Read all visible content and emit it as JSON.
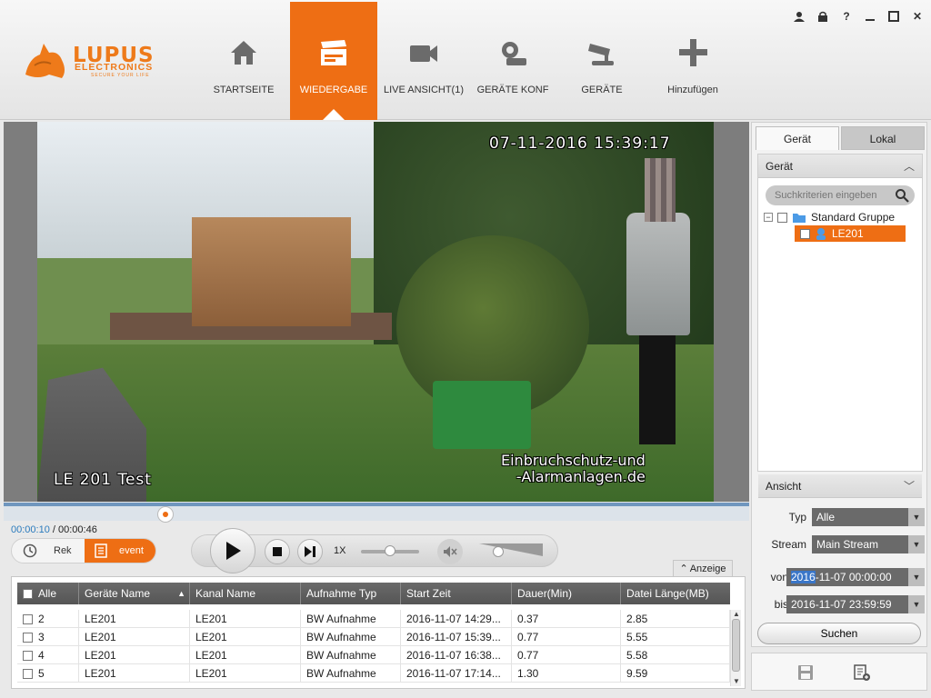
{
  "window_controls": [
    "user-icon",
    "lock-icon",
    "help-icon",
    "minimize-icon",
    "maximize-icon",
    "close-icon"
  ],
  "window_glyphs": {
    "help": "?",
    "close": "✕"
  },
  "brand": {
    "name": "LUPUS",
    "sub": "ELECTRONICS",
    "tagline": "SECURE YOUR LIFE",
    "color": "#ee7a1a"
  },
  "nav": {
    "active_color": "#ee6e14",
    "items": [
      {
        "label": "STARTSEITE",
        "icon": "home-icon"
      },
      {
        "label": "WIEDERGABE",
        "icon": "clapperboard-icon",
        "active": true
      },
      {
        "label": "LIVE ANSICHT(1)",
        "icon": "video-camera-icon"
      },
      {
        "label": "GERÄTE KONF",
        "icon": "gear-config-icon"
      },
      {
        "label": "GERÄTE",
        "icon": "cctv-camera-icon"
      },
      {
        "label": "Hinzufügen",
        "icon": "plus-icon"
      }
    ]
  },
  "video": {
    "osd_timestamp": "07-11-2016 15:39:17",
    "osd_camera_name": "LE 201 Test",
    "osd_watermark": "Einbruchschutz-und\n-Alarmanlagen.de"
  },
  "playback": {
    "current_time": "00:00:10",
    "separator": " / ",
    "total_time": "00:00:46",
    "progress_fraction": 0.2174,
    "speed": "1X",
    "speed_level": 0.5,
    "volume_level": 0.3
  },
  "mode": {
    "rek_label": "Rek",
    "event_label": "event",
    "active": "event"
  },
  "anzeige_label": "Anzeige",
  "table": {
    "columns": [
      "Alle",
      "Geräte Name",
      "Kanal Name",
      "Aufnahme Typ",
      "Start Zeit",
      "Dauer(Min)",
      "Datei Länge(MB)"
    ],
    "rows": [
      {
        "no": "2",
        "device": "LE201",
        "channel": "LE201",
        "type": "BW Aufnahme",
        "start": "2016-11-07 14:29...",
        "duration": "0.37",
        "size": "2.85"
      },
      {
        "no": "3",
        "device": "LE201",
        "channel": "LE201",
        "type": "BW Aufnahme",
        "start": "2016-11-07 15:39...",
        "duration": "0.77",
        "size": "5.55"
      },
      {
        "no": "4",
        "device": "LE201",
        "channel": "LE201",
        "type": "BW Aufnahme",
        "start": "2016-11-07 16:38...",
        "duration": "0.77",
        "size": "5.58"
      },
      {
        "no": "5",
        "device": "LE201",
        "channel": "LE201",
        "type": "BW Aufnahme",
        "start": "2016-11-07 17:14...",
        "duration": "1.30",
        "size": "9.59"
      }
    ]
  },
  "right": {
    "tabs": [
      "Gerät",
      "Lokal"
    ],
    "device_section": "Gerät",
    "search_placeholder": "Suchkriterien eingeben",
    "tree_group": "Standard Gruppe",
    "tree_item": "LE201",
    "ansicht_section": "Ansicht",
    "typ_label": "Typ",
    "typ_value": "Alle",
    "stream_label": "Stream",
    "stream_value": "Main Stream",
    "von_label": "von",
    "von_year": "2016",
    "von_rest": "-11-07 00:00:00",
    "bis_label": "bis",
    "bis_value": "2016-11-07 23:59:59",
    "search_button": "Suchen"
  }
}
